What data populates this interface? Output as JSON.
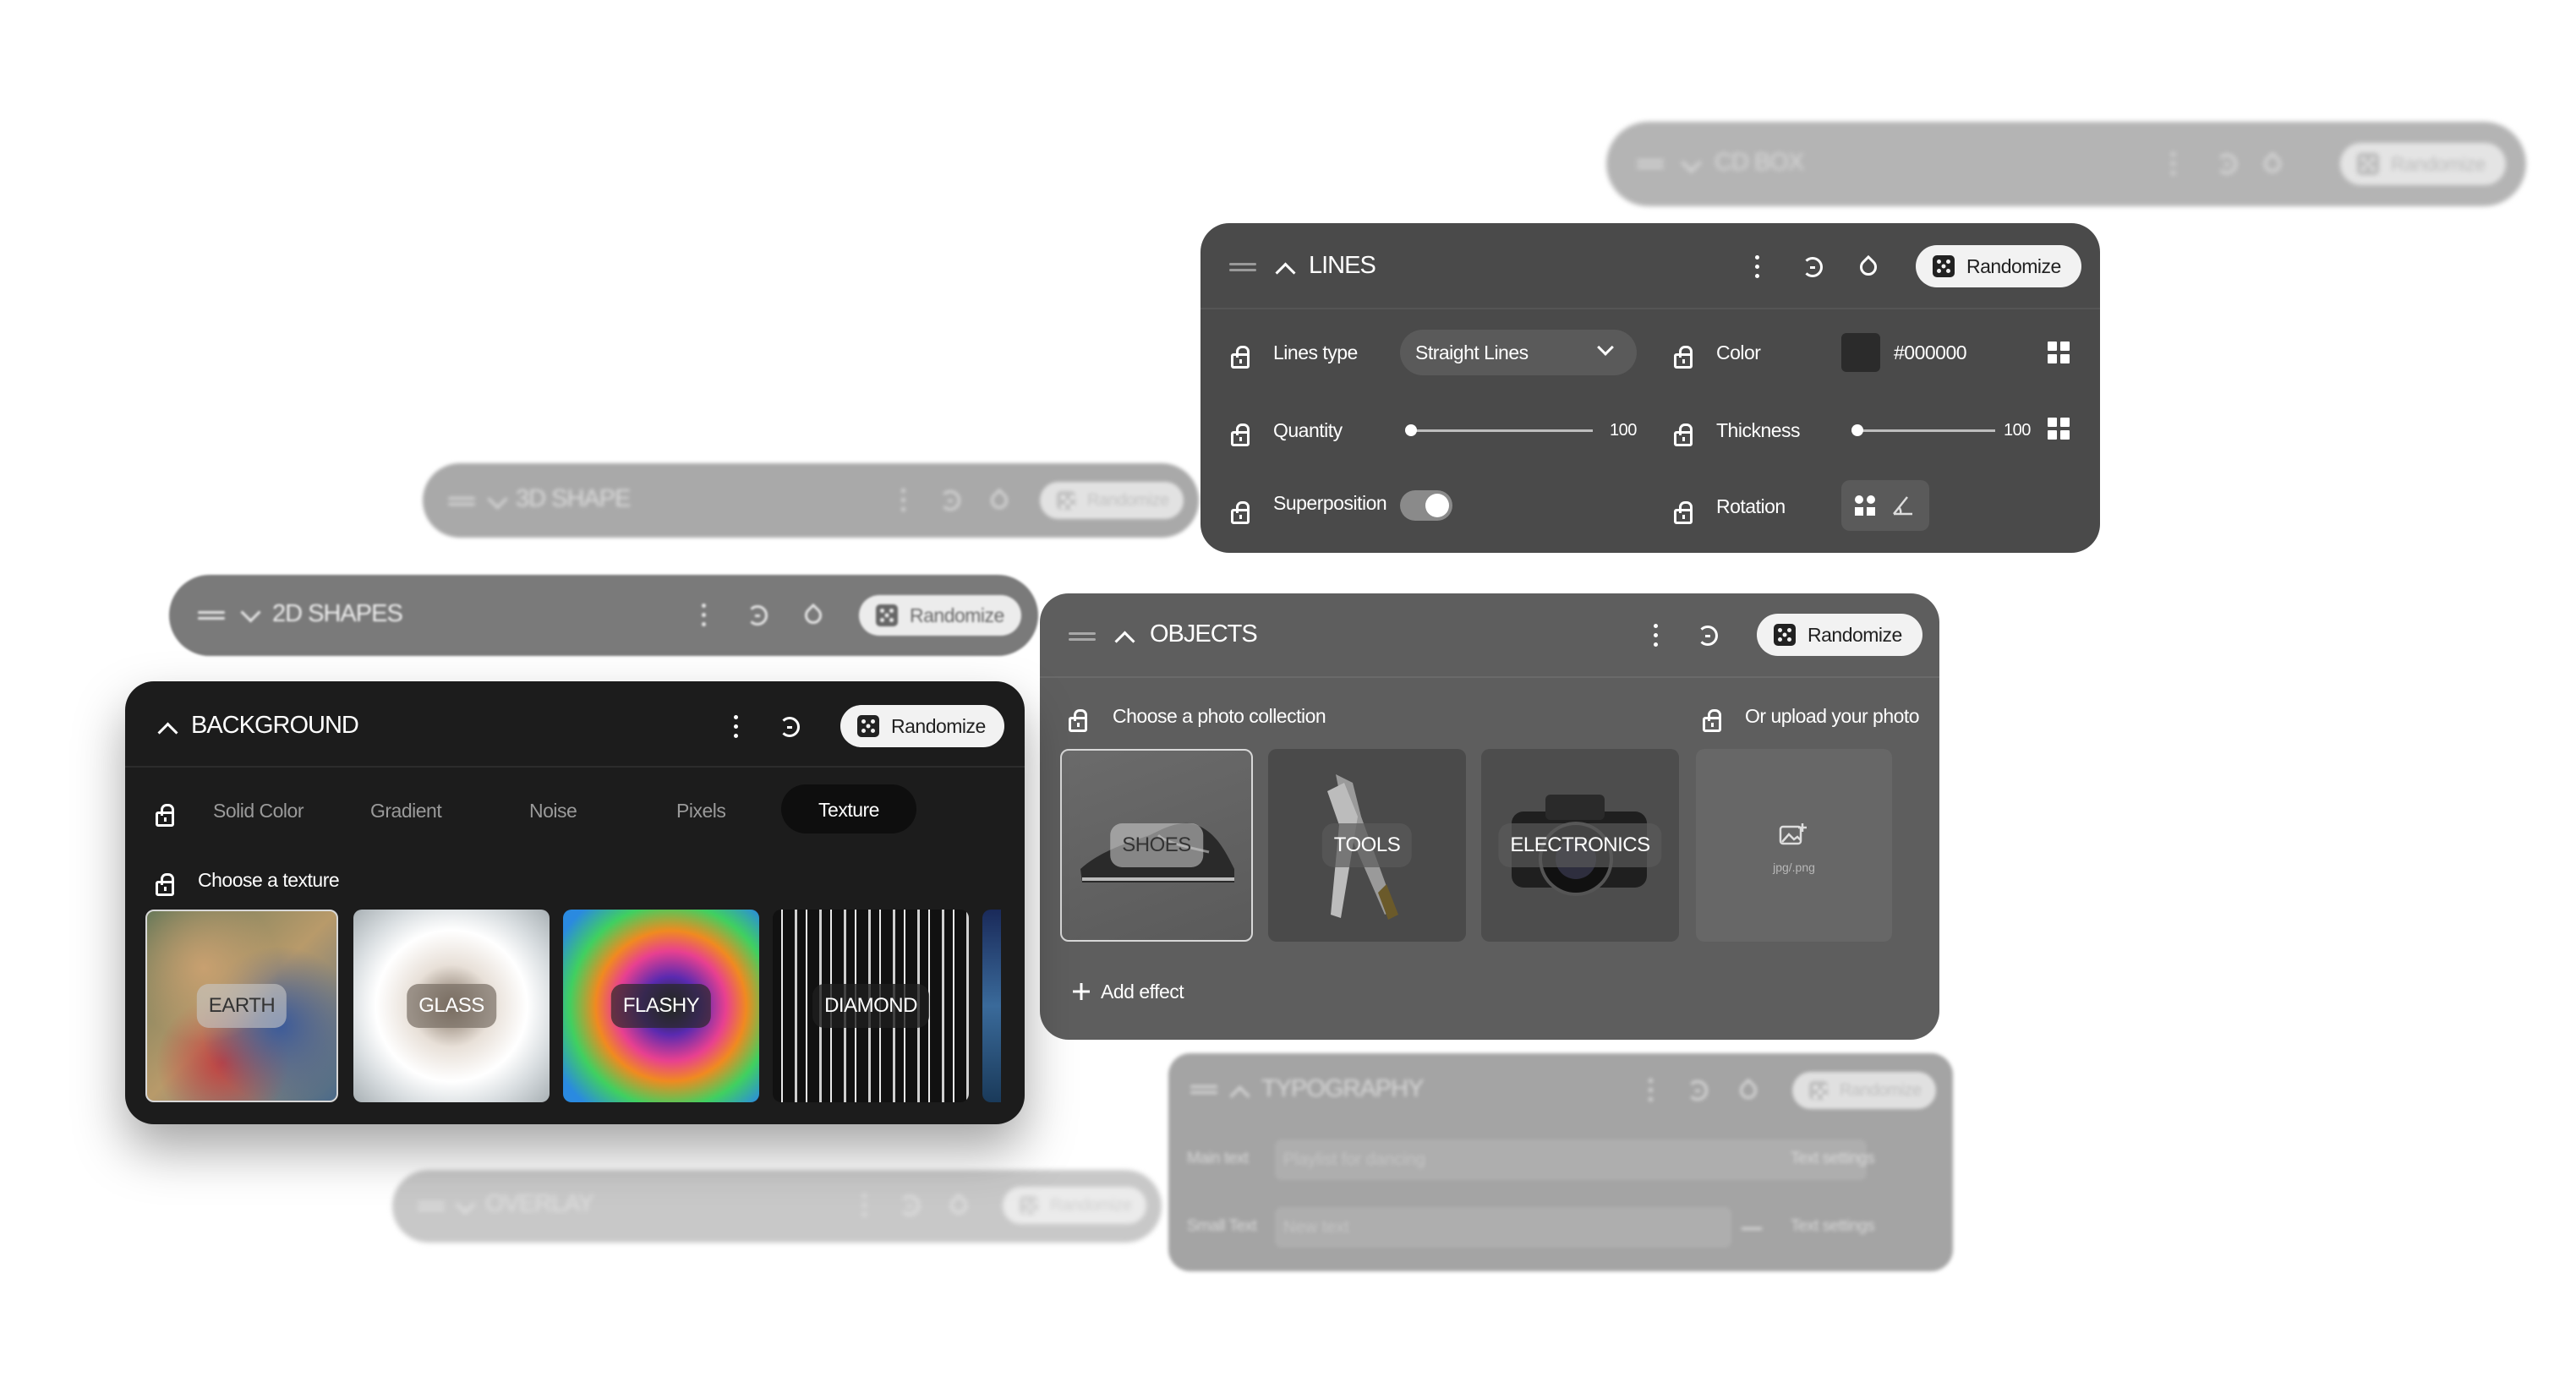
{
  "randomize_label": "Randomize",
  "panels": {
    "cd_box": {
      "title": "CD BOX"
    },
    "shape3d": {
      "title": "3D SHAPE"
    },
    "shapes2d": {
      "title": "2D SHAPES"
    },
    "overlay": {
      "title": "OVERLAY"
    },
    "lines": {
      "title": "LINES",
      "lines_type_label": "Lines type",
      "lines_type_value": "Straight Lines",
      "color_label": "Color",
      "color_value": "#000000",
      "color_swatch": "#2b2b2b",
      "quantity_label": "Quantity",
      "quantity_value": "100",
      "quantity_level": 0.03,
      "thickness_label": "Thickness",
      "thickness_value": "100",
      "thickness_level": 0.03,
      "superposition_label": "Superposition",
      "superposition_on": true,
      "rotation_label": "Rotation"
    },
    "background": {
      "title": "BACKGROUND",
      "tabs": [
        "Solid Color",
        "Gradient",
        "Noise",
        "Pixels",
        "Texture"
      ],
      "active_tab": "Texture",
      "choose_label": "Choose a texture",
      "textures": [
        "EARTH",
        "GLASS",
        "FLASHY",
        "DIAMOND"
      ]
    },
    "objects": {
      "title": "OBJECTS",
      "choose_label": "Choose a photo collection",
      "upload_label": "Or upload your photo",
      "collections": [
        "SHOES",
        "TOOLS",
        "ELECTRONICS"
      ],
      "upload_hint": "jpg/.png",
      "add_effect": "Add effect"
    },
    "typography": {
      "title": "TYPOGRAPHY",
      "main_text_label": "Main text",
      "main_text_placeholder": "Playlist for dancing",
      "small_text_label": "Small Text",
      "small_text_placeholder": "New text",
      "text_settings": "Text settings"
    }
  },
  "colors": {
    "panel_dark": "#1c1c1c",
    "panel_mid": "#4a4a4a",
    "panel_grey": "#5e5e5e",
    "panel_light_grey": "#9a9a9a"
  },
  "icons": [
    "grip-icon",
    "chevron-up-icon",
    "chevron-down-icon",
    "kebab-icon",
    "reset-icon",
    "drop-icon",
    "dice-icon",
    "lock-icon",
    "grid-icon",
    "rotation-icon",
    "image-upload-icon",
    "plus-icon"
  ]
}
